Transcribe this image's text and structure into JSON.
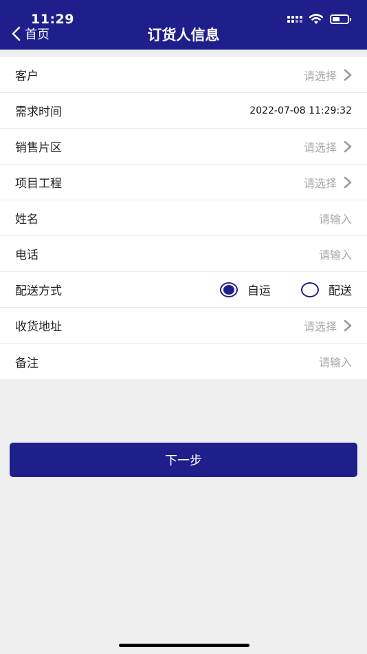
{
  "status_bar": {
    "time": "11:29"
  },
  "nav": {
    "back_label": "首页",
    "title": "订货人信息"
  },
  "form": {
    "rows": [
      {
        "label": "客户",
        "placeholder": "请选择"
      },
      {
        "label": "需求时间",
        "value": "2022-07-08 11:29:32"
      },
      {
        "label": "销售片区",
        "placeholder": "请选择"
      },
      {
        "label": "项目工程",
        "placeholder": "请选择"
      },
      {
        "label": "姓名",
        "placeholder": "请输入"
      },
      {
        "label": "电话",
        "placeholder": "请输入"
      },
      {
        "label": "配送方式",
        "options": [
          {
            "label": "自运",
            "selected": true
          },
          {
            "label": "配送",
            "selected": false
          }
        ]
      },
      {
        "label": "收货地址",
        "placeholder": "请选择"
      },
      {
        "label": "备注",
        "placeholder": "请输入"
      }
    ]
  },
  "next_button": {
    "label": "下一步"
  },
  "colors": {
    "primary": "#1f1f8c",
    "background": "#efefef",
    "placeholder": "#a6a6a6"
  }
}
